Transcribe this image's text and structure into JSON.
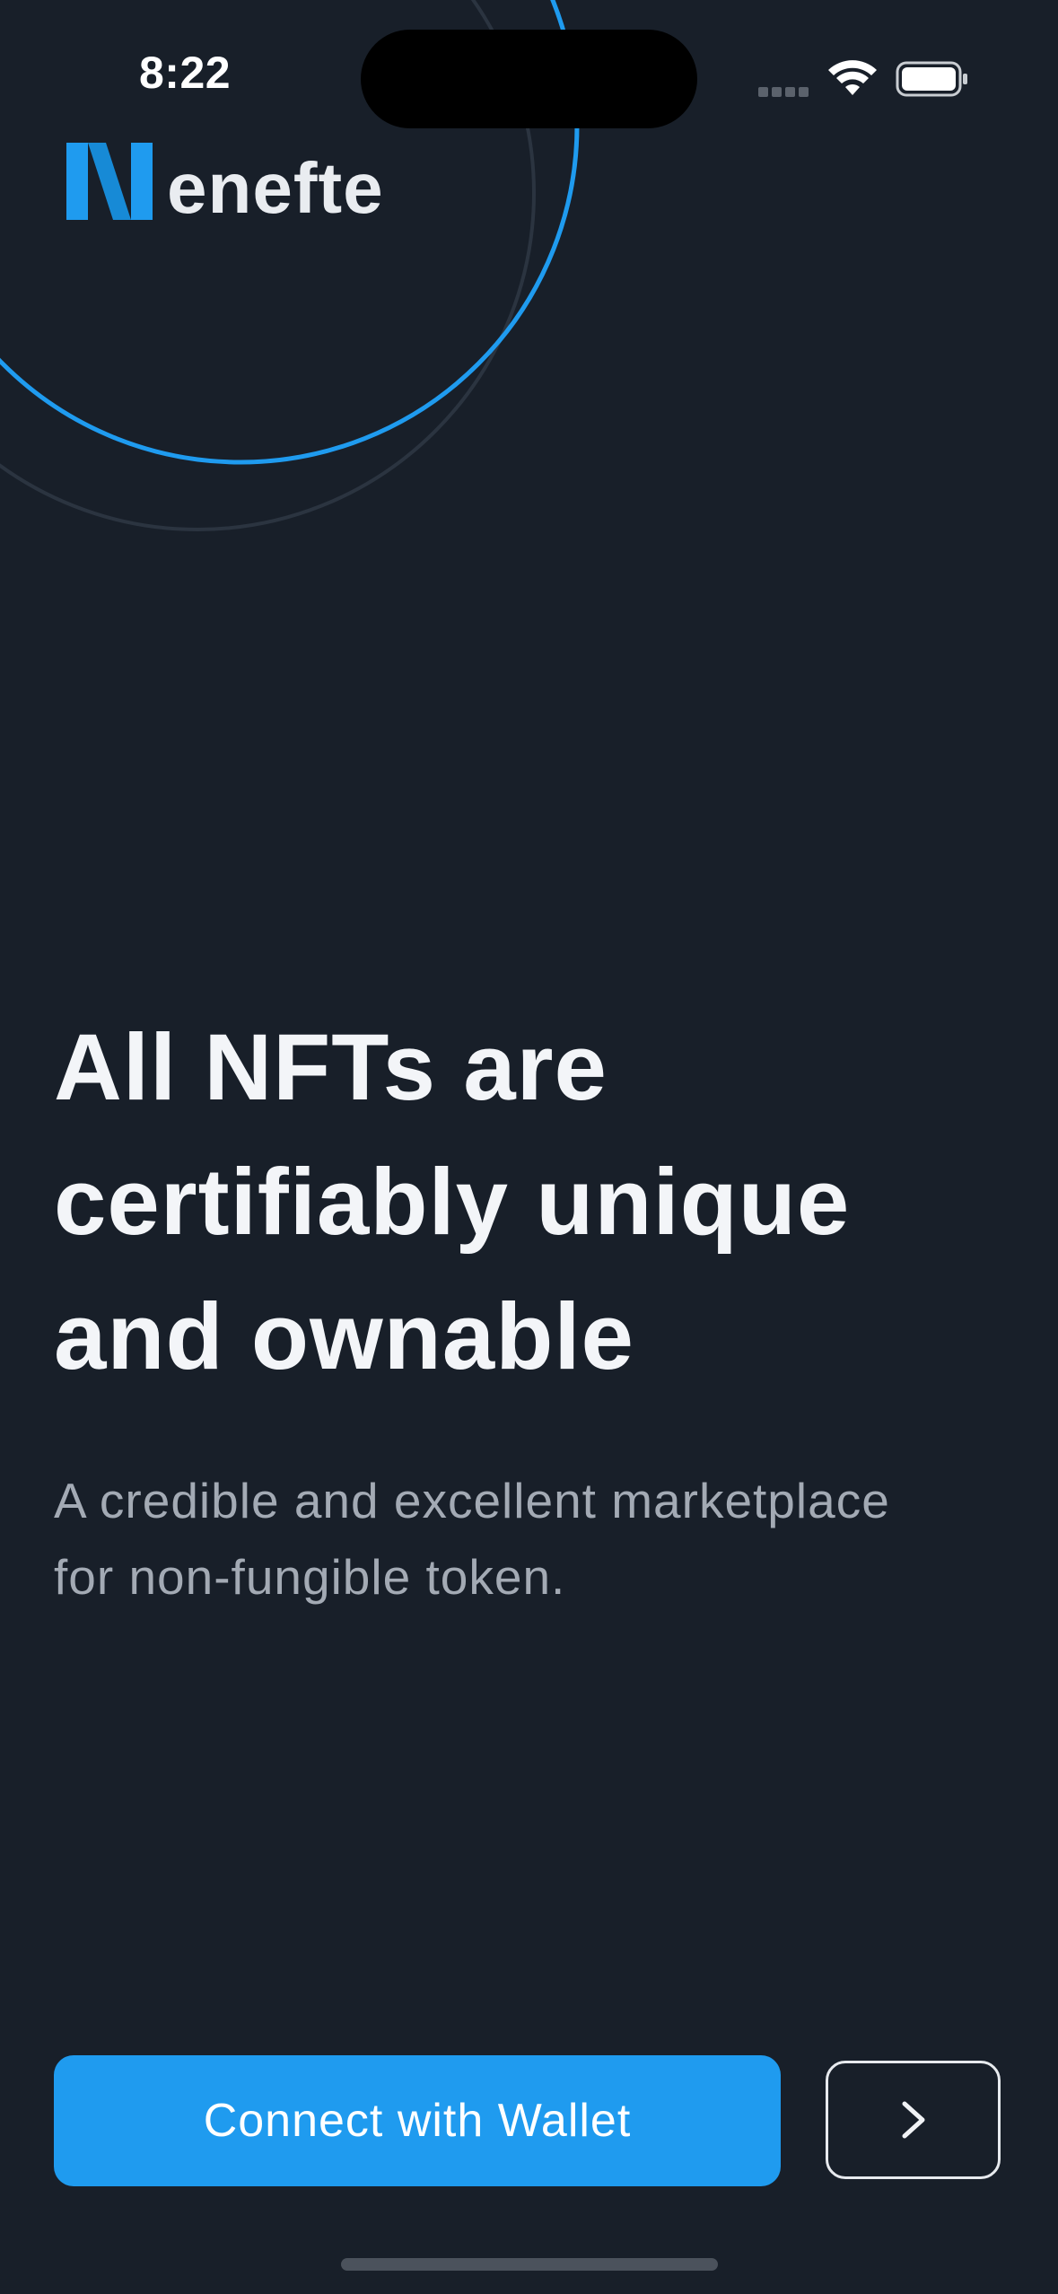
{
  "status_bar": {
    "time": "8:22",
    "icons": [
      "signal-icon",
      "wifi-icon",
      "battery-icon"
    ]
  },
  "brand": {
    "logo_text": "enefte",
    "logo_mark_icon": "n-logo-mark-icon",
    "accent_color": "#1f9bef"
  },
  "hero": {
    "headline_lines": [
      "All NFTs are",
      "certifiably unique",
      "and ownable"
    ],
    "subtitle_lines": [
      "A credible and excellent marketplace",
      "for non-fungible token."
    ]
  },
  "actions": {
    "connect_label": "Connect with Wallet",
    "next_icon": "chevron-right-icon"
  },
  "colors": {
    "background": "#181f29",
    "primary_button": "#1f9bef",
    "headline": "#f3f5f8",
    "subtitle": "#a3aab4"
  }
}
